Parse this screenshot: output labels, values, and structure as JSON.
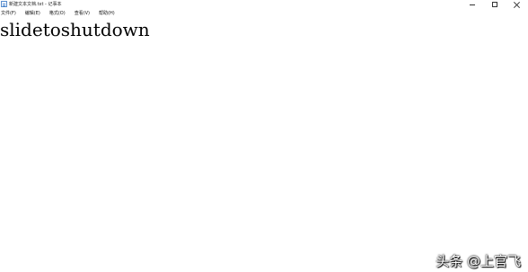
{
  "window": {
    "title": "新建文本文档.txt - 记事本",
    "icon": "notepad-icon",
    "controls": {
      "minimize": "minimize-icon",
      "maximize": "maximize-icon",
      "close": "close-icon"
    }
  },
  "menu": {
    "items": [
      {
        "label": "文件(F)"
      },
      {
        "label": "编辑(E)"
      },
      {
        "label": "格式(O)"
      },
      {
        "label": "查看(V)"
      },
      {
        "label": "帮助(H)"
      }
    ]
  },
  "editor": {
    "text": "slidetoshutdown"
  },
  "watermark": {
    "text": "头条 @上官飞"
  }
}
